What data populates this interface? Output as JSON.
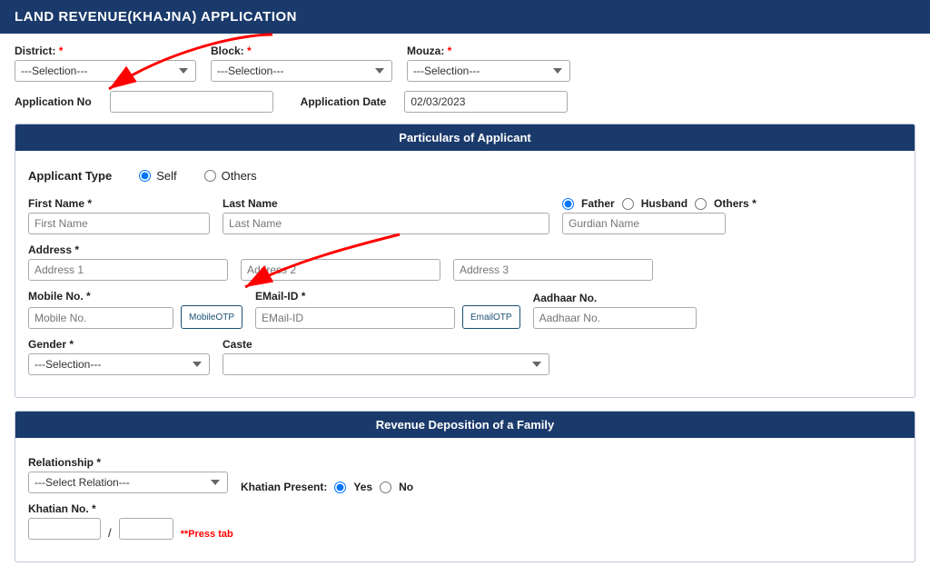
{
  "header": {
    "title": "LAND REVENUE(KHAJNA) APPLICATION"
  },
  "top_fields": {
    "district_label": "District:",
    "district_placeholder": "---Selection---",
    "block_label": "Block:",
    "block_placeholder": "---Selection---",
    "mouza_label": "Mouza:",
    "mouza_placeholder": "---Selection---",
    "appno_label": "Application No",
    "appdate_label": "Application Date",
    "appdate_value": "02/03/2023"
  },
  "particulars_section": {
    "header": "Particulars of Applicant",
    "applicant_type_label": "Applicant Type",
    "self_label": "Self",
    "others_label": "Others",
    "firstname_label": "First Name",
    "firstname_placeholder": "First Name",
    "lastname_label": "Last Name",
    "lastname_placeholder": "Last Name",
    "father_label": "Father",
    "husband_label": "Husband",
    "others2_label": "Others",
    "guardian_placeholder": "Gurdian Name",
    "address_label": "Address",
    "address1_placeholder": "Address 1",
    "address2_placeholder": "Address 2",
    "address3_placeholder": "Address 3",
    "mobile_label": "Mobile No.",
    "mobile_placeholder": "Mobile No.",
    "mobileotp_label": "MobileOTP",
    "email_label": "EMail-ID",
    "email_placeholder": "EMail-ID",
    "emailotp_label": "EmailOTP",
    "aadhaar_label": "Aadhaar No.",
    "aadhaar_placeholder": "Aadhaar No.",
    "gender_label": "Gender",
    "gender_placeholder": "---Selection---",
    "caste_label": "Caste",
    "caste_placeholder": ""
  },
  "revenue_section": {
    "header": "Revenue Deposition of a Family",
    "relationship_label": "Relationship",
    "relationship_placeholder": "---Select Relation---",
    "khatian_present_label": "Khatian Present:",
    "yes_label": "Yes",
    "no_label": "No",
    "khatian_no_label": "Khatian No.",
    "press_tab": "**Press tab"
  },
  "required_marker": "*"
}
